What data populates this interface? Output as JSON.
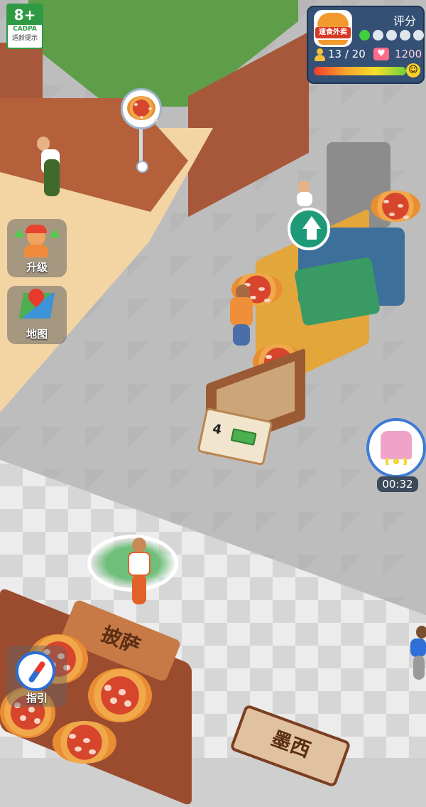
{
  "age_rating": {
    "number": "8+",
    "org": "CADPA",
    "caption": "适龄提示"
  },
  "restaurant_panel": {
    "logo_text": "速食外卖",
    "rating_label": "评分",
    "rating_stars_filled": 1,
    "rating_stars_total": 5,
    "customers": "13 / 20",
    "likes": "1200",
    "satisfaction_level": 1.0,
    "colors": {
      "panel": "#28466e",
      "star_on": "#3fcf3f",
      "likes": "#ff6b8a"
    }
  },
  "side_menu": {
    "upgrade_label": "升级",
    "map_label": "地图",
    "guide_label": "指引"
  },
  "tray": {
    "price": "4",
    "icon": "cash-icon"
  },
  "skate_powerup": {
    "icon": "roller-skate-icon",
    "timer": "00:32"
  },
  "station_signs": {
    "pizza_station": "披萨",
    "other_station": "墨西"
  },
  "icons": {
    "upgrade_bubble": "arrow-up-icon",
    "order_bubble": "pizza-icon",
    "compass": "compass-icon",
    "map": "map-icon"
  }
}
